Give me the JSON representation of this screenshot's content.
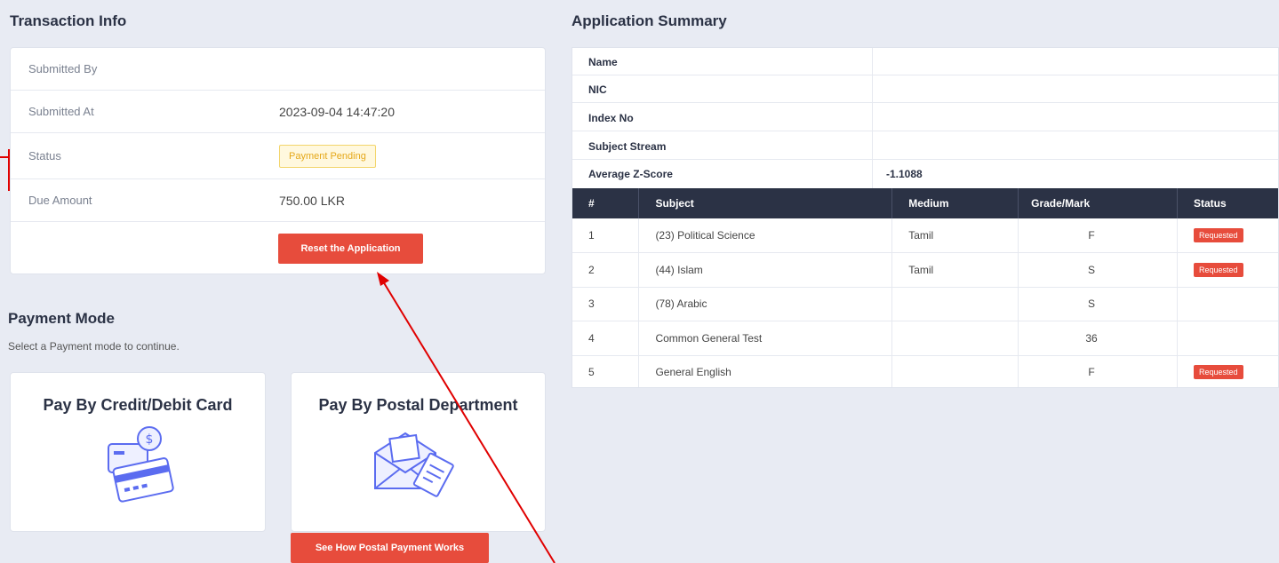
{
  "transaction": {
    "title": "Transaction Info",
    "rows": [
      {
        "label": "Submitted By",
        "value": ""
      },
      {
        "label": "Submitted At",
        "value": "2023-09-04 14:47:20"
      },
      {
        "label": "Status",
        "value": "Payment Pending"
      },
      {
        "label": "Due Amount",
        "value": "750.00 LKR"
      }
    ],
    "reset_button": "Reset the Application"
  },
  "payment": {
    "title": "Payment Mode",
    "subtitle": "Select a Payment mode to continue.",
    "card_option": "Pay By Credit/Debit Card",
    "postal_option": "Pay By Postal Department",
    "postal_help_button": "See How Postal Payment Works"
  },
  "summary": {
    "title": "Application Summary",
    "fields": [
      {
        "label": "Name",
        "value": ""
      },
      {
        "label": "NIC",
        "value": ""
      },
      {
        "label": "Index No",
        "value": ""
      },
      {
        "label": "Subject Stream",
        "value": ""
      },
      {
        "label": "Average Z-Score",
        "value": "-1.1088"
      }
    ],
    "table": {
      "headers": [
        "#",
        "Subject",
        "Medium",
        "Grade/Mark",
        "Status"
      ],
      "rows": [
        {
          "num": "1",
          "subject": "(23) Political Science",
          "medium": "Tamil",
          "grade": "F",
          "status": "Requested"
        },
        {
          "num": "2",
          "subject": "(44) Islam",
          "medium": "Tamil",
          "grade": "S",
          "status": "Requested"
        },
        {
          "num": "3",
          "subject": "(78) Arabic",
          "medium": "",
          "grade": "S",
          "status": ""
        },
        {
          "num": "4",
          "subject": "Common General Test",
          "medium": "",
          "grade": "36",
          "status": ""
        },
        {
          "num": "5",
          "subject": "General English",
          "medium": "",
          "grade": "F",
          "status": "Requested"
        }
      ]
    }
  },
  "colors": {
    "accent_red": "#e74c3c",
    "header_dark": "#2b3245",
    "pending_yellow": "#e5a81a",
    "illustration_blue": "#5b6cf0"
  }
}
